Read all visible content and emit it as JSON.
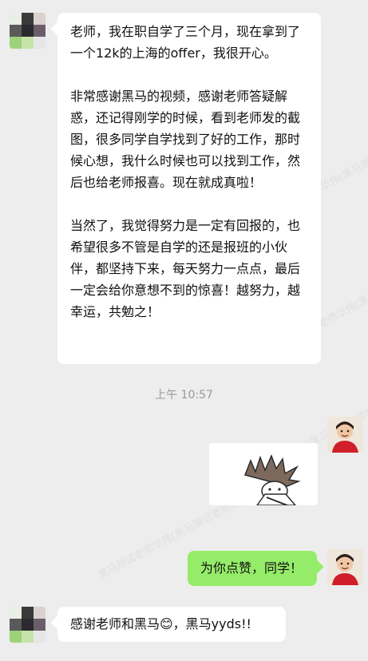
{
  "messages": {
    "m1": {
      "p1": "老师，我在职自学了三个月，现在拿到了一个12k的上海的offer，我很开心。",
      "p2": "非常感谢黑马的视频，感谢老师答疑解惑，还记得刚学的时候，看到老师发的截图，很多同学自学找到了好的工作，那时候心想，我什么时候也可以找到工作，然后也给老师报喜。现在就成真啦！",
      "p3": "当然了，我觉得努力是一定有回报的，也希望很多不管是自学的还是报班的小伙伴，都坚持下来，每天努力一点点，最后一定会给你意想不到的惊喜！越努力，越幸运，共勉之！"
    },
    "timestamp": "上午 10:57",
    "m2": "为你点赞，同学！",
    "m3": "感谢老师和黑马😊，黑马yyds!!"
  },
  "watermark": "黑马测试老师华伟(黑马测试老师华伟)",
  "colors": {
    "background": "#ededed",
    "bubble_left": "#ffffff",
    "bubble_right": "#95ec69",
    "timestamp": "#999999"
  }
}
